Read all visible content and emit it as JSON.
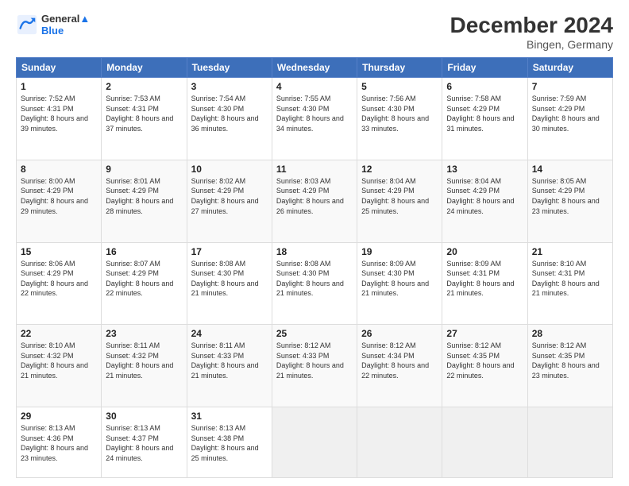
{
  "header": {
    "logo_line1": "General",
    "logo_line2": "Blue",
    "month": "December 2024",
    "location": "Bingen, Germany"
  },
  "days_of_week": [
    "Sunday",
    "Monday",
    "Tuesday",
    "Wednesday",
    "Thursday",
    "Friday",
    "Saturday"
  ],
  "weeks": [
    [
      {
        "day": "1",
        "sunrise": "Sunrise: 7:52 AM",
        "sunset": "Sunset: 4:31 PM",
        "daylight": "Daylight: 8 hours and 39 minutes."
      },
      {
        "day": "2",
        "sunrise": "Sunrise: 7:53 AM",
        "sunset": "Sunset: 4:31 PM",
        "daylight": "Daylight: 8 hours and 37 minutes."
      },
      {
        "day": "3",
        "sunrise": "Sunrise: 7:54 AM",
        "sunset": "Sunset: 4:30 PM",
        "daylight": "Daylight: 8 hours and 36 minutes."
      },
      {
        "day": "4",
        "sunrise": "Sunrise: 7:55 AM",
        "sunset": "Sunset: 4:30 PM",
        "daylight": "Daylight: 8 hours and 34 minutes."
      },
      {
        "day": "5",
        "sunrise": "Sunrise: 7:56 AM",
        "sunset": "Sunset: 4:30 PM",
        "daylight": "Daylight: 8 hours and 33 minutes."
      },
      {
        "day": "6",
        "sunrise": "Sunrise: 7:58 AM",
        "sunset": "Sunset: 4:29 PM",
        "daylight": "Daylight: 8 hours and 31 minutes."
      },
      {
        "day": "7",
        "sunrise": "Sunrise: 7:59 AM",
        "sunset": "Sunset: 4:29 PM",
        "daylight": "Daylight: 8 hours and 30 minutes."
      }
    ],
    [
      {
        "day": "8",
        "sunrise": "Sunrise: 8:00 AM",
        "sunset": "Sunset: 4:29 PM",
        "daylight": "Daylight: 8 hours and 29 minutes."
      },
      {
        "day": "9",
        "sunrise": "Sunrise: 8:01 AM",
        "sunset": "Sunset: 4:29 PM",
        "daylight": "Daylight: 8 hours and 28 minutes."
      },
      {
        "day": "10",
        "sunrise": "Sunrise: 8:02 AM",
        "sunset": "Sunset: 4:29 PM",
        "daylight": "Daylight: 8 hours and 27 minutes."
      },
      {
        "day": "11",
        "sunrise": "Sunrise: 8:03 AM",
        "sunset": "Sunset: 4:29 PM",
        "daylight": "Daylight: 8 hours and 26 minutes."
      },
      {
        "day": "12",
        "sunrise": "Sunrise: 8:04 AM",
        "sunset": "Sunset: 4:29 PM",
        "daylight": "Daylight: 8 hours and 25 minutes."
      },
      {
        "day": "13",
        "sunrise": "Sunrise: 8:04 AM",
        "sunset": "Sunset: 4:29 PM",
        "daylight": "Daylight: 8 hours and 24 minutes."
      },
      {
        "day": "14",
        "sunrise": "Sunrise: 8:05 AM",
        "sunset": "Sunset: 4:29 PM",
        "daylight": "Daylight: 8 hours and 23 minutes."
      }
    ],
    [
      {
        "day": "15",
        "sunrise": "Sunrise: 8:06 AM",
        "sunset": "Sunset: 4:29 PM",
        "daylight": "Daylight: 8 hours and 22 minutes."
      },
      {
        "day": "16",
        "sunrise": "Sunrise: 8:07 AM",
        "sunset": "Sunset: 4:29 PM",
        "daylight": "Daylight: 8 hours and 22 minutes."
      },
      {
        "day": "17",
        "sunrise": "Sunrise: 8:08 AM",
        "sunset": "Sunset: 4:30 PM",
        "daylight": "Daylight: 8 hours and 21 minutes."
      },
      {
        "day": "18",
        "sunrise": "Sunrise: 8:08 AM",
        "sunset": "Sunset: 4:30 PM",
        "daylight": "Daylight: 8 hours and 21 minutes."
      },
      {
        "day": "19",
        "sunrise": "Sunrise: 8:09 AM",
        "sunset": "Sunset: 4:30 PM",
        "daylight": "Daylight: 8 hours and 21 minutes."
      },
      {
        "day": "20",
        "sunrise": "Sunrise: 8:09 AM",
        "sunset": "Sunset: 4:31 PM",
        "daylight": "Daylight: 8 hours and 21 minutes."
      },
      {
        "day": "21",
        "sunrise": "Sunrise: 8:10 AM",
        "sunset": "Sunset: 4:31 PM",
        "daylight": "Daylight: 8 hours and 21 minutes."
      }
    ],
    [
      {
        "day": "22",
        "sunrise": "Sunrise: 8:10 AM",
        "sunset": "Sunset: 4:32 PM",
        "daylight": "Daylight: 8 hours and 21 minutes."
      },
      {
        "day": "23",
        "sunrise": "Sunrise: 8:11 AM",
        "sunset": "Sunset: 4:32 PM",
        "daylight": "Daylight: 8 hours and 21 minutes."
      },
      {
        "day": "24",
        "sunrise": "Sunrise: 8:11 AM",
        "sunset": "Sunset: 4:33 PM",
        "daylight": "Daylight: 8 hours and 21 minutes."
      },
      {
        "day": "25",
        "sunrise": "Sunrise: 8:12 AM",
        "sunset": "Sunset: 4:33 PM",
        "daylight": "Daylight: 8 hours and 21 minutes."
      },
      {
        "day": "26",
        "sunrise": "Sunrise: 8:12 AM",
        "sunset": "Sunset: 4:34 PM",
        "daylight": "Daylight: 8 hours and 22 minutes."
      },
      {
        "day": "27",
        "sunrise": "Sunrise: 8:12 AM",
        "sunset": "Sunset: 4:35 PM",
        "daylight": "Daylight: 8 hours and 22 minutes."
      },
      {
        "day": "28",
        "sunrise": "Sunrise: 8:12 AM",
        "sunset": "Sunset: 4:35 PM",
        "daylight": "Daylight: 8 hours and 23 minutes."
      }
    ],
    [
      {
        "day": "29",
        "sunrise": "Sunrise: 8:13 AM",
        "sunset": "Sunset: 4:36 PM",
        "daylight": "Daylight: 8 hours and 23 minutes."
      },
      {
        "day": "30",
        "sunrise": "Sunrise: 8:13 AM",
        "sunset": "Sunset: 4:37 PM",
        "daylight": "Daylight: 8 hours and 24 minutes."
      },
      {
        "day": "31",
        "sunrise": "Sunrise: 8:13 AM",
        "sunset": "Sunset: 4:38 PM",
        "daylight": "Daylight: 8 hours and 25 minutes."
      },
      null,
      null,
      null,
      null
    ]
  ]
}
